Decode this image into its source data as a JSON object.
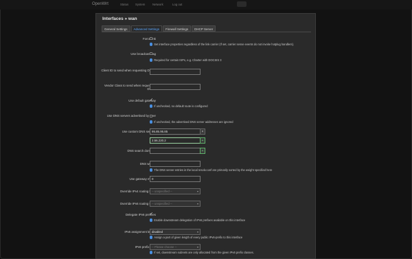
{
  "nav": {
    "brand": "OpenWrt",
    "items": [
      "Status",
      "System",
      "Network",
      "Log out"
    ]
  },
  "modal": {
    "title": "Interfaces » wan",
    "tabs": [
      "General Settings",
      "Advanced Settings",
      "Firewall Settings",
      "DHCP Server"
    ]
  },
  "form": {
    "force_link": {
      "label": "Force link",
      "help": "Set interface properties regardless of the link carrier (If set, carrier sense events do not invoke hotplug handlers)."
    },
    "broadcast_flag": {
      "label": "Use broadcast flag",
      "help": "Required for certain ISPs, e.g. Charter with DOCSIS 3"
    },
    "client_id": {
      "label": "Client ID to send when requesting DHCP",
      "value": ""
    },
    "vendor_class": {
      "label": "Vendor Class to send when requesting DHCP",
      "value": ""
    },
    "default_gateway": {
      "label": "Use default gateway",
      "checked": true,
      "check_glyph": "✓",
      "help": "If unchecked, no default route is configured"
    },
    "peer_dns": {
      "label": "Use DNS servers advertised by peer",
      "help": "If unchecked, the advertised DNS server addresses are ignored"
    },
    "custom_dns": {
      "label": "Use custom DNS servers",
      "servers": [
        "95.85.95.85",
        "2.56.220.2"
      ],
      "remove_label": "×",
      "add_label": "+"
    },
    "dns_search": {
      "label": "DNS search domains",
      "value": "",
      "add_label": "+"
    },
    "dns_weight": {
      "label": "DNS weight",
      "value": "",
      "help": "The DNS server entries in the local resolv.conf are primarily sorted by the weight specified here"
    },
    "gateway_metric": {
      "label": "Use gateway metric",
      "value": "0"
    },
    "ipv4_table": {
      "label": "Override IPv4 routing table",
      "value": "-- unspecified --"
    },
    "ipv6_table": {
      "label": "Override IPv6 routing table",
      "value": "-- unspecified --"
    },
    "delegate_prefix": {
      "label": "Delegate IPv6 prefixes",
      "checked": true,
      "check_glyph": "✓",
      "help": "Enable downstream delegation of IPv6 prefixes available on this interface"
    },
    "ipv6_assignment": {
      "label": "IPv6 assignment length",
      "value": "disabled",
      "help": "Assign a part of given length of every public IPv6-prefix to this interface"
    },
    "ipv6_prefix_filter": {
      "label": "IPv6 prefix filter",
      "value": "-- Please choose --",
      "help": "If set, downstream subnets are only allocated from the given IPv6 prefix classes."
    }
  },
  "caret_glyph": "▾",
  "colors": {
    "accent": "#4a90e2",
    "active_tab": "#5aa7ff",
    "add_green": "#5fb26a"
  }
}
